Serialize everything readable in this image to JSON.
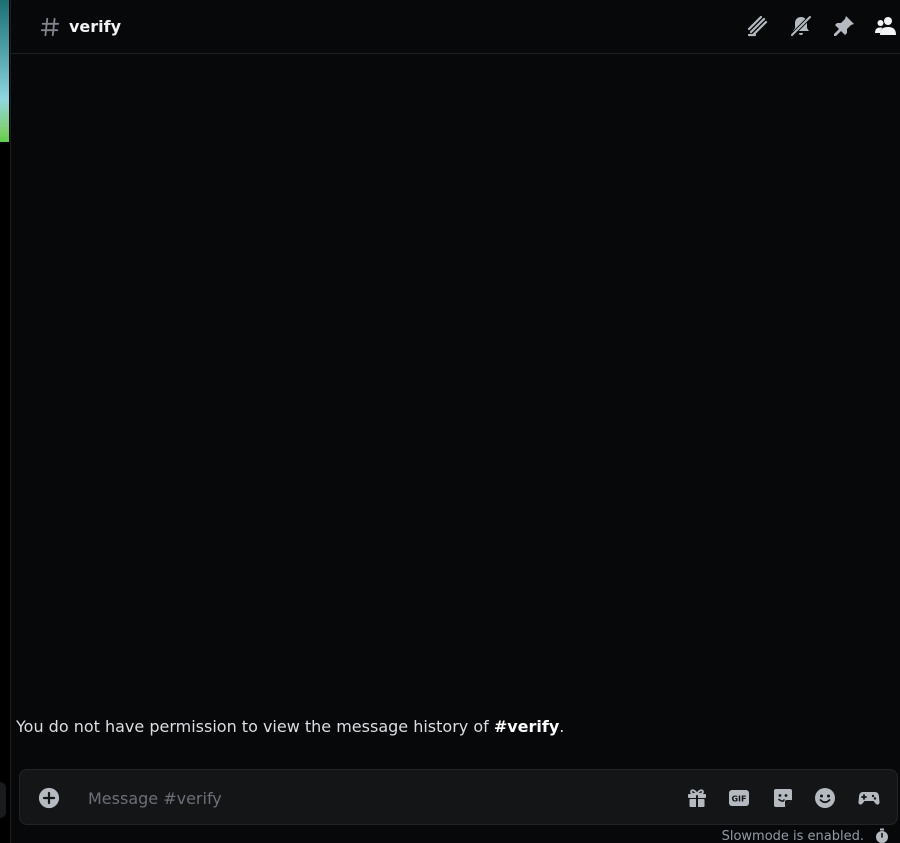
{
  "channel": {
    "name": "verify",
    "prefix_icon": "hash-icon"
  },
  "header_icons": [
    {
      "name": "threads-icon",
      "label": "Threads"
    },
    {
      "name": "mute-bell-icon",
      "label": "Notification Settings"
    },
    {
      "name": "pin-icon",
      "label": "Pinned Messages"
    },
    {
      "name": "members-icon",
      "label": "Member List"
    }
  ],
  "permission_notice": {
    "prefix": "You do not have permission to view the message history of ",
    "channel": "#verify",
    "suffix": "."
  },
  "composer": {
    "placeholder": "Message #verify",
    "value": "",
    "icons": [
      "plus-circle-icon",
      "gift-icon",
      "gif-icon",
      "sticker-icon",
      "emoji-icon",
      "activities-icon"
    ],
    "gif_label": "GIF"
  },
  "slowmode": {
    "text": "Slowmode is enabled."
  },
  "colors": {
    "background": "#07080a",
    "composer_bg": "#141517",
    "text": "#dbdee1",
    "muted": "#949ba4"
  }
}
